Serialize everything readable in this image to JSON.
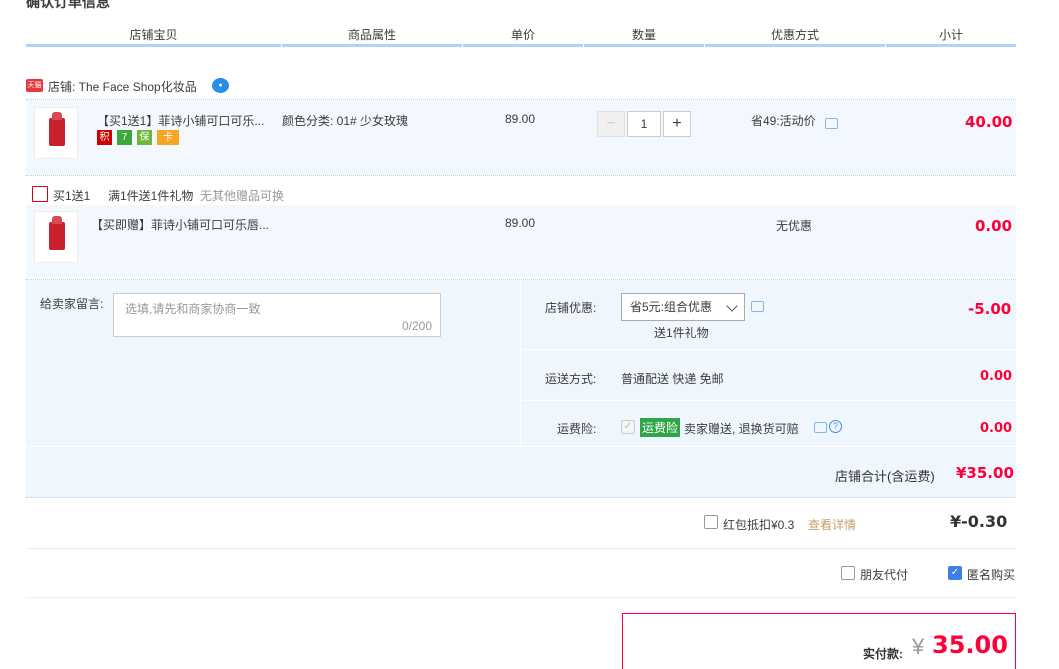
{
  "page": {
    "title": "确认订单信息"
  },
  "headers": [
    "店铺宝贝",
    "商品属性",
    "单价",
    "数量",
    "优惠方式",
    "小计"
  ],
  "shop": {
    "badge": "天猫",
    "label": "店铺: The Face Shop化妆品"
  },
  "item1": {
    "title": "【买1送1】菲诗小铺可口可乐...",
    "badges": [
      "积",
      "7",
      "保",
      "卡"
    ],
    "attr": "颜色分类: 01# 少女玫瑰",
    "price": "89.00",
    "qty": "1",
    "minus": "−",
    "plus": "+",
    "discount": "省49:活动价",
    "subtotal": "40.00"
  },
  "gift": {
    "label": "买1送1",
    "rule": "满1件送1件礼物",
    "note": "无其他赠品可换"
  },
  "item2": {
    "title": "【买即赠】菲诗小铺可口可乐唇...",
    "price": "89.00",
    "discount": "无优惠",
    "subtotal": "0.00"
  },
  "message": {
    "label": "给卖家留言:",
    "placeholder": "选填,请先和商家协商一致",
    "counter": "0/200"
  },
  "shop_discount": {
    "label": "店铺优惠:",
    "selected": "省5元:组合优惠",
    "sub": "送1件礼物",
    "amount": "-5.00"
  },
  "shipping": {
    "label": "运送方式:",
    "value": "普通配送 快递 免邮",
    "amount": "0.00"
  },
  "insurance": {
    "label": "运费险:",
    "tag": "运费险",
    "value": "卖家赠送, 退换货可赔",
    "amount": "0.00"
  },
  "shop_total": {
    "label": "店铺合计(含运费)",
    "amount": "¥35.00"
  },
  "redpacket": {
    "label": "红包抵扣¥0.3",
    "link": "查看详情",
    "amount": "¥-0.30"
  },
  "options": {
    "friend_pay": "朋友代付",
    "anonymous": "匿名购买"
  },
  "payment": {
    "label": "实付款:",
    "currency": "¥",
    "amount": "35.00"
  }
}
